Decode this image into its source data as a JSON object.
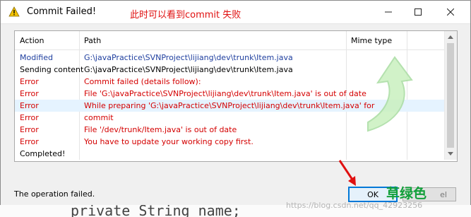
{
  "window": {
    "title": "Commit Failed!",
    "annotation": "此时可以看到commit 失败"
  },
  "columns": [
    "Action",
    "Path",
    "Mime type"
  ],
  "rows": [
    {
      "action": "Modified",
      "path": "G:\\javaPractice\\SVNProject\\lijiang\\dev\\trunk\\Item.java",
      "color": "#1f3f9f"
    },
    {
      "action": "Sending content",
      "path": "G:\\javaPractice\\SVNProject\\lijiang\\dev\\trunk\\Item.java",
      "color": "#000000"
    },
    {
      "action": "Error",
      "path": "Commit failed (details follow):",
      "color": "#d40000"
    },
    {
      "action": "Error",
      "path": "File 'G:\\javaPractice\\SVNProject\\lijiang\\dev\\trunk\\Item.java' is out of date",
      "color": "#d40000"
    },
    {
      "action": "Error",
      "path": "While preparing 'G:\\javaPractice\\SVNProject\\lijiang\\dev\\trunk\\Item.java' for",
      "color": "#d40000",
      "selected": true
    },
    {
      "action": "Error",
      "path": " commit",
      "color": "#d40000"
    },
    {
      "action": "Error",
      "path": "File '/dev/trunk/Item.java' is out of date",
      "color": "#d40000"
    },
    {
      "action": "Error",
      "path": "You have to update your working copy first.",
      "color": "#d40000"
    },
    {
      "action": "Completed!",
      "path": "",
      "color": "#000000"
    }
  ],
  "status": "The operation failed.",
  "ok_label": "OK",
  "annotation_bottom": "草绿色",
  "other_button_label": "el",
  "code_line": "private String name;",
  "watermark": "https://blog.csdn.net/qq_42923256"
}
